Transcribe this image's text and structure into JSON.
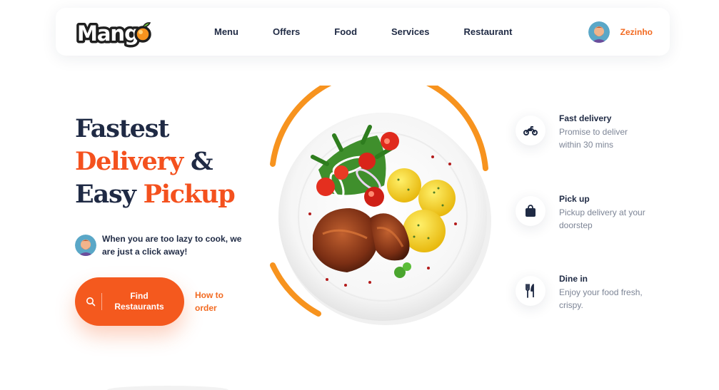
{
  "brand": {
    "logo_text": "Mango"
  },
  "nav": {
    "items": [
      {
        "label": "Menu"
      },
      {
        "label": "Offers"
      },
      {
        "label": "Food"
      },
      {
        "label": "Services"
      },
      {
        "label": "Restaurant"
      }
    ],
    "user_name": "Zezinho"
  },
  "hero": {
    "title_line1": "Fastest",
    "title_line2_orange": "Delivery",
    "title_line2_dark": " &",
    "title_line3_dark": "Easy ",
    "title_line3_orange": "Pickup",
    "tagline": "When you are too lazy to cook, we are just a click away!",
    "find_button_line1": "Find",
    "find_button_line2": "Restaurants",
    "how_to_order_line1": "How to",
    "how_to_order_line2": "order"
  },
  "features": [
    {
      "icon": "motorbike-icon",
      "title": "Fast delivery",
      "description": "Promise to deliver within 30 mins"
    },
    {
      "icon": "shopping-bag-icon",
      "title": "Pick up",
      "description": "Pickup delivery at your doorstep"
    },
    {
      "icon": "fork-knife-icon",
      "title": "Dine in",
      "description": "Enjoy your food fresh, crispy."
    }
  ],
  "colors": {
    "accent": "#f4511e",
    "accent_light": "#f7931e",
    "dark": "#1f2a44",
    "muted": "#7d8596"
  }
}
